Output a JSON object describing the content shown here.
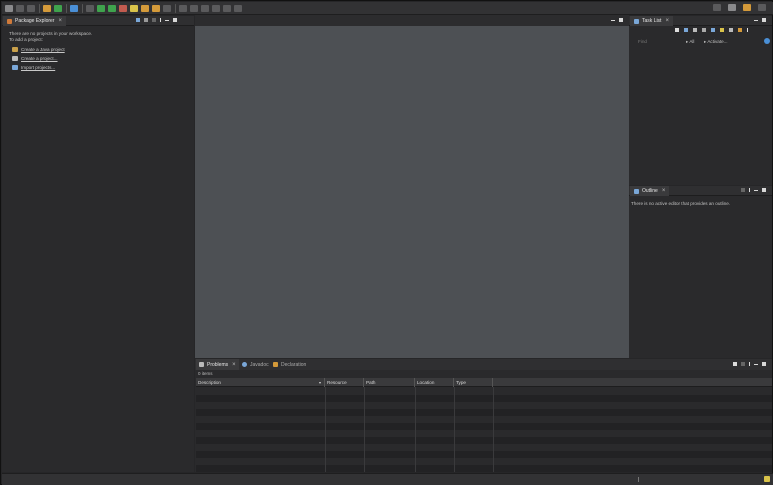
{
  "package_explorer": {
    "tab_label": "Package Explorer",
    "message_line1": "There are no projects in your workspace.",
    "message_line2": "To add a project:",
    "links": [
      "Create a Java project",
      "Create a project...",
      "Import projects..."
    ]
  },
  "task_list": {
    "tab_label": "Task List",
    "find_placeholder": "Find",
    "filter_all": "All",
    "activate_label": "Activate..."
  },
  "outline": {
    "tab_label": "Outline",
    "message": "There is no active editor that provides an outline."
  },
  "problems_area": {
    "tabs": [
      "Problems",
      "Javadoc",
      "Declaration"
    ],
    "item_count": "0 items",
    "columns": [
      "Description",
      "Resource",
      "Path",
      "Location",
      "Type"
    ]
  },
  "colors": {
    "editor_bg": "#4d5054",
    "panel_bg": "#2a2a2c",
    "toolbar_bg": "#323234"
  }
}
